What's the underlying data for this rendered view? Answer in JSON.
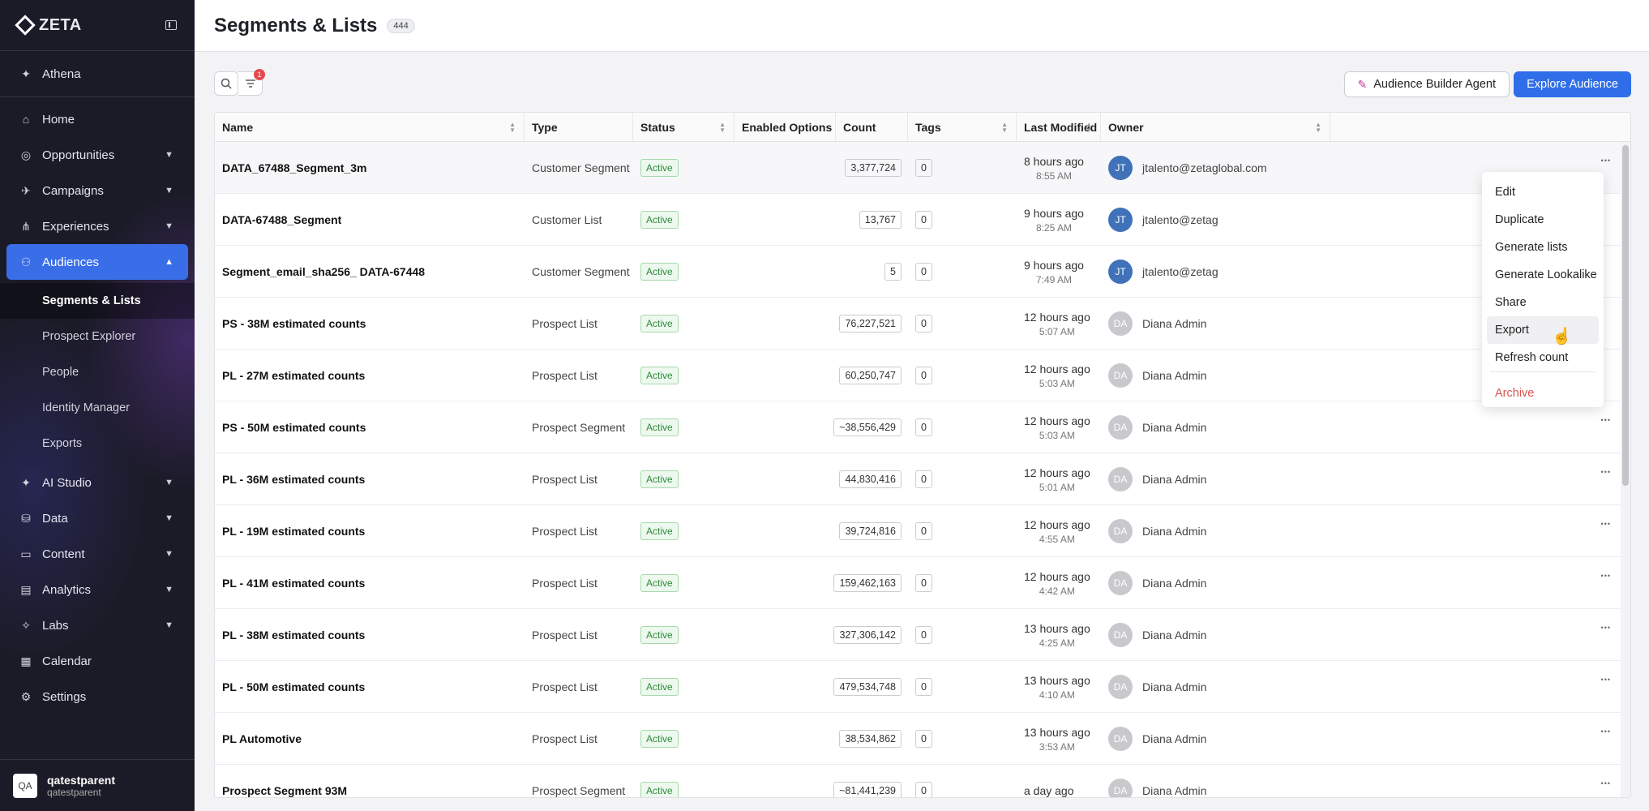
{
  "sidebar": {
    "brand": "ZETA",
    "top_item": "Athena",
    "items": [
      {
        "label": "Home",
        "icon": "home-icon",
        "chevron": false
      },
      {
        "label": "Opportunities",
        "icon": "target-icon",
        "chevron": true
      },
      {
        "label": "Campaigns",
        "icon": "megaphone-icon",
        "chevron": true
      },
      {
        "label": "Experiences",
        "icon": "flow-icon",
        "chevron": true
      },
      {
        "label": "Audiences",
        "icon": "audience-icon",
        "chevron": true,
        "active": true
      }
    ],
    "audience_sub": [
      "Segments & Lists",
      "Prospect Explorer",
      "People",
      "Identity Manager",
      "Exports"
    ],
    "items_after": [
      {
        "label": "AI Studio",
        "icon": "sparkle-icon",
        "chevron": true
      },
      {
        "label": "Data",
        "icon": "database-icon",
        "chevron": true
      },
      {
        "label": "Content",
        "icon": "folder-icon",
        "chevron": true
      },
      {
        "label": "Analytics",
        "icon": "chart-icon",
        "chevron": true
      },
      {
        "label": "Labs",
        "icon": "flask-icon",
        "chevron": true
      },
      {
        "label": "Calendar",
        "icon": "calendar-icon",
        "chevron": false
      },
      {
        "label": "Settings",
        "icon": "gear-icon",
        "chevron": false
      }
    ],
    "user": {
      "initials": "QA",
      "name": "qatestparent",
      "sub": "qatestparent"
    }
  },
  "header": {
    "title": "Segments & Lists",
    "count": "444"
  },
  "toolbar": {
    "filter_count": "1",
    "agent_label": "Audience Builder Agent",
    "explore_label": "Explore Audience"
  },
  "table": {
    "columns": [
      "Name",
      "Type",
      "Status",
      "Enabled Options",
      "Count",
      "Tags",
      "Last Modified",
      "Owner"
    ],
    "rows": [
      {
        "name": "DATA_67488_Segment_3m",
        "type": "Customer Segment",
        "status": "Active",
        "count": "3,377,724",
        "tags": "0",
        "mod1": "8 hours ago",
        "mod2": "8:55 AM",
        "initials": "JT",
        "owner": "jtalento@zetaglobal.com"
      },
      {
        "name": "DATA-67488_Segment",
        "type": "Customer List",
        "status": "Active",
        "count": "13,767",
        "tags": "0",
        "mod1": "9 hours ago",
        "mod2": "8:25 AM",
        "initials": "JT",
        "owner": "jtalento@zetag"
      },
      {
        "name": "Segment_email_sha256_ DATA-67448",
        "type": "Customer Segment",
        "status": "Active",
        "count": "5",
        "tags": "0",
        "mod1": "9 hours ago",
        "mod2": "7:49 AM",
        "initials": "JT",
        "owner": "jtalento@zetag"
      },
      {
        "name": "PS - 38M estimated counts",
        "type": "Prospect List",
        "status": "Active",
        "count": "76,227,521",
        "tags": "0",
        "mod1": "12 hours ago",
        "mod2": "5:07 AM",
        "initials": "DA",
        "owner": "Diana Admin"
      },
      {
        "name": "PL - 27M estimated counts",
        "type": "Prospect List",
        "status": "Active",
        "count": "60,250,747",
        "tags": "0",
        "mod1": "12 hours ago",
        "mod2": "5:03 AM",
        "initials": "DA",
        "owner": "Diana Admin"
      },
      {
        "name": "PS - 50M estimated counts",
        "type": "Prospect Segment",
        "status": "Active",
        "count": "~38,556,429",
        "tags": "0",
        "mod1": "12 hours ago",
        "mod2": "5:03 AM",
        "initials": "DA",
        "owner": "Diana Admin"
      },
      {
        "name": "PL - 36M estimated counts",
        "type": "Prospect List",
        "status": "Active",
        "count": "44,830,416",
        "tags": "0",
        "mod1": "12 hours ago",
        "mod2": "5:01 AM",
        "initials": "DA",
        "owner": "Diana Admin"
      },
      {
        "name": "PL - 19M estimated counts",
        "type": "Prospect List",
        "status": "Active",
        "count": "39,724,816",
        "tags": "0",
        "mod1": "12 hours ago",
        "mod2": "4:55 AM",
        "initials": "DA",
        "owner": "Diana Admin"
      },
      {
        "name": "PL - 41M estimated counts",
        "type": "Prospect List",
        "status": "Active",
        "count": "159,462,163",
        "tags": "0",
        "mod1": "12 hours ago",
        "mod2": "4:42 AM",
        "initials": "DA",
        "owner": "Diana Admin"
      },
      {
        "name": "PL - 38M estimated counts",
        "type": "Prospect List",
        "status": "Active",
        "count": "327,306,142",
        "tags": "0",
        "mod1": "13 hours ago",
        "mod2": "4:25 AM",
        "initials": "DA",
        "owner": "Diana Admin"
      },
      {
        "name": "PL - 50M estimated counts",
        "type": "Prospect List",
        "status": "Active",
        "count": "479,534,748",
        "tags": "0",
        "mod1": "13 hours ago",
        "mod2": "4:10 AM",
        "initials": "DA",
        "owner": "Diana Admin"
      },
      {
        "name": "PL Automotive",
        "type": "Prospect List",
        "status": "Active",
        "count": "38,534,862",
        "tags": "0",
        "mod1": "13 hours ago",
        "mod2": "3:53 AM",
        "initials": "DA",
        "owner": "Diana Admin"
      },
      {
        "name": "Prospect Segment 93M",
        "type": "Prospect Segment",
        "status": "Active",
        "count": "~81,441,239",
        "tags": "0",
        "mod1": "a day ago",
        "mod2": "",
        "initials": "DA",
        "owner": "Diana Admin"
      }
    ]
  },
  "context_menu": {
    "items": [
      "Edit",
      "Duplicate",
      "Generate lists",
      "Generate Lookalike",
      "Share",
      "Export",
      "Refresh count"
    ],
    "archive": "Archive",
    "hovered": "Export"
  }
}
